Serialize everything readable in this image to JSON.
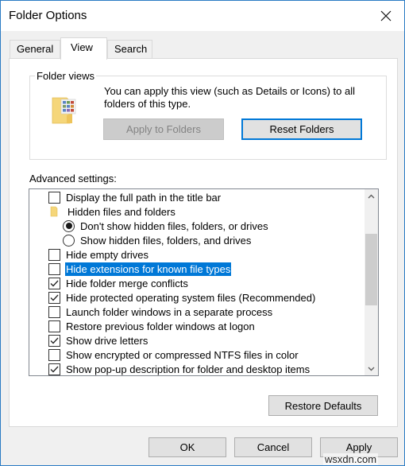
{
  "window": {
    "title": "Folder Options",
    "close_icon": "close-icon"
  },
  "tabs": [
    {
      "label": "General",
      "active": false
    },
    {
      "label": "View",
      "active": true
    },
    {
      "label": "Search",
      "active": false
    }
  ],
  "folder_views": {
    "legend": "Folder views",
    "icon": "folder-details-icon",
    "description": "You can apply this view (such as Details or Icons) to all folders of this type.",
    "apply_button": {
      "label": "Apply to Folders",
      "enabled": false
    },
    "reset_button": {
      "label": "Reset Folders",
      "enabled": true
    }
  },
  "advanced": {
    "label": "Advanced settings:",
    "items": [
      {
        "type": "checkbox",
        "label": "Display the full path in the title bar",
        "checked": false,
        "indent": 1
      },
      {
        "type": "folder",
        "label": "Hidden files and folders",
        "indent": 1
      },
      {
        "type": "radio",
        "label": "Don't show hidden files, folders, or drives",
        "checked": true,
        "indent": 2
      },
      {
        "type": "radio",
        "label": "Show hidden files, folders, and drives",
        "checked": false,
        "indent": 2
      },
      {
        "type": "checkbox",
        "label": "Hide empty drives",
        "checked": false,
        "indent": 1
      },
      {
        "type": "checkbox",
        "label": "Hide extensions for known file types",
        "checked": false,
        "indent": 1,
        "selected": true
      },
      {
        "type": "checkbox",
        "label": "Hide folder merge conflicts",
        "checked": true,
        "indent": 1
      },
      {
        "type": "checkbox",
        "label": "Hide protected operating system files (Recommended)",
        "checked": true,
        "indent": 1
      },
      {
        "type": "checkbox",
        "label": "Launch folder windows in a separate process",
        "checked": false,
        "indent": 1
      },
      {
        "type": "checkbox",
        "label": "Restore previous folder windows at logon",
        "checked": false,
        "indent": 1
      },
      {
        "type": "checkbox",
        "label": "Show drive letters",
        "checked": true,
        "indent": 1
      },
      {
        "type": "checkbox",
        "label": "Show encrypted or compressed NTFS files in color",
        "checked": false,
        "indent": 1
      },
      {
        "type": "checkbox",
        "label": "Show pop-up description for folder and desktop items",
        "checked": true,
        "indent": 1
      }
    ],
    "scroll_position_fraction": 0.35,
    "visible_fraction": 0.45,
    "restore_defaults_label": "Restore Defaults"
  },
  "footer": {
    "ok_label": "OK",
    "cancel_label": "Cancel",
    "apply_label": "Apply"
  },
  "watermark": "wsxdn.com",
  "colors": {
    "accent": "#0078d7",
    "window_border": "#2b7bc4",
    "selection": "#0078d7"
  }
}
